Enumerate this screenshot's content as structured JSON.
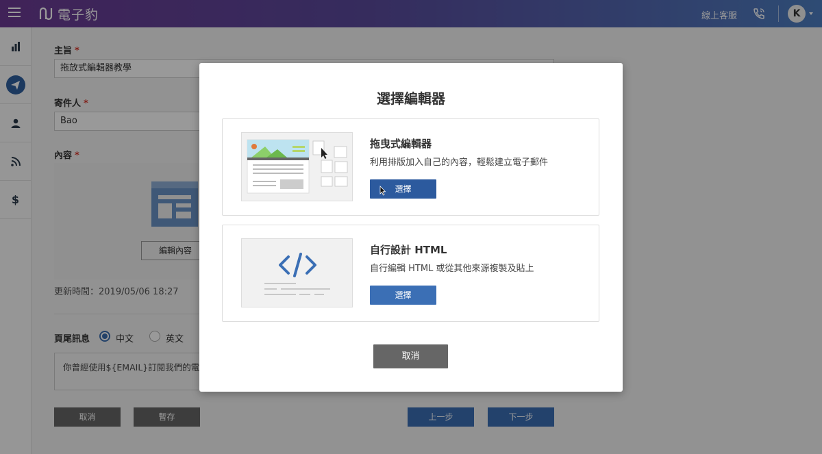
{
  "header": {
    "brand": "電子豹",
    "support_label": "線上客服",
    "avatar_initial": "K"
  },
  "sidebar": {
    "items": [
      {
        "icon": "bar-chart-icon"
      },
      {
        "icon": "paper-plane-icon",
        "active": true
      },
      {
        "icon": "user-icon"
      },
      {
        "icon": "rss-icon"
      },
      {
        "icon": "dollar-icon",
        "label": "$"
      }
    ]
  },
  "form": {
    "subject_label": "主旨",
    "subject_value": "拖放式編輯器教學",
    "sender_label": "寄件人",
    "sender_value": "Bao",
    "content_label": "內容",
    "required_mark": "*",
    "edit_content_label": "編輯內容",
    "updated_time": "更新時間：2019/05/06 18:27",
    "footer_label": "頁尾訊息",
    "lang_options": [
      "中文",
      "英文"
    ],
    "lang_selected": "中文",
    "footer_text": "你曾經使用${EMAIL}訂閱我們的電子",
    "cancel_label": "取消",
    "save_label": "暫存",
    "prev_label": "上一步",
    "next_label": "下一步"
  },
  "modal": {
    "title": "選擇編輯器",
    "options": [
      {
        "title": "拖曳式編輯器",
        "description": "利用排版加入自己的內容，輕鬆建立電子郵件",
        "button": "選擇"
      },
      {
        "title": "自行設計 HTML",
        "description": "自行編輯 HTML 或從其他來源複製及貼上",
        "button": "選擇"
      }
    ],
    "cancel_label": "取消"
  },
  "colors": {
    "primary": "#3b6fb5",
    "header_start": "#6c3a93",
    "header_end": "#4d7ec1",
    "dark_button": "#666666",
    "required": "#d9382c"
  }
}
